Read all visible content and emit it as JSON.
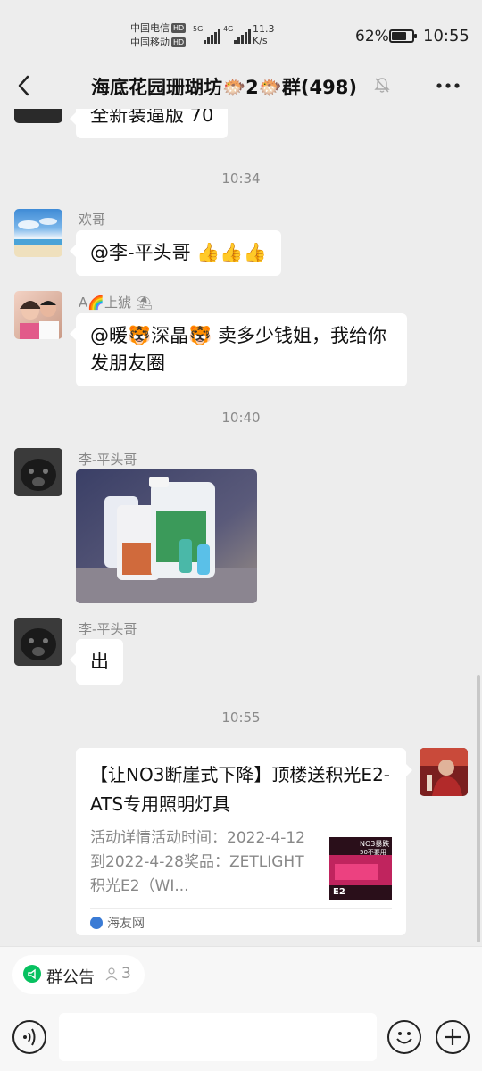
{
  "status_bar": {
    "carrier1": "中国电信",
    "carrier2": "中国移动",
    "hd": "HD",
    "net1": "5G",
    "net2": "4G",
    "speed_value": "11.3",
    "speed_unit": "K/s",
    "battery_pct": "62%",
    "battery_level": 0.62,
    "clock": "10:55"
  },
  "header": {
    "title": "海底花园珊瑚坊🐡2🐡群(498)"
  },
  "chat": {
    "partial_message": "全新装逼版 70",
    "time1": "10:34",
    "msg1": {
      "sender": "欢哥",
      "text": "@李-平头哥 ",
      "emoji": "👍👍👍"
    },
    "msg2": {
      "sender": "A🌈上猇 ⛱",
      "text": "@暖🐯深晶🐯 卖多少钱姐，我给你发朋友圈"
    },
    "time2": "10:40",
    "msg3": {
      "sender": "李-平头哥"
    },
    "msg4": {
      "sender": "李-平头哥",
      "text": "出"
    },
    "time3": "10:55",
    "card": {
      "title": "【让NO3断崖式下降】顶楼送积光E2-ATS专用照明灯具",
      "desc": "活动详情活动时间：2022-4-12到2022-4-28奖品：ZETLIGHT积光E2（WI...",
      "source": "海友网",
      "thumb_text1": "NO3暴跌",
      "thumb_text2": "50不要用",
      "thumb_text3": "E2"
    }
  },
  "bottom": {
    "notice_label": "群公告",
    "notice_count": "3"
  },
  "colors": {
    "background": "#ededed",
    "accent": "#07c160",
    "bubble": "#ffffff"
  }
}
